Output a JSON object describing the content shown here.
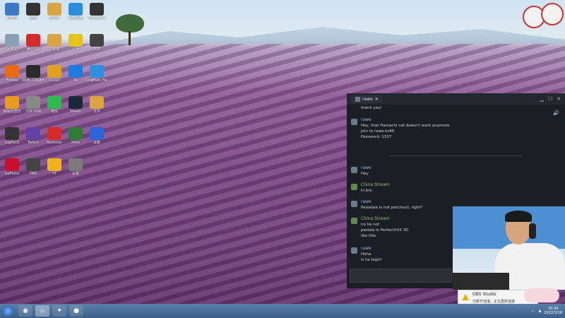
{
  "desktop": {
    "icons": [
      {
        "label": "计算机",
        "icon": "computer-icon",
        "color": "#3b78c7"
      },
      {
        "label": "游戏",
        "icon": "game-icon",
        "color": "#333333"
      },
      {
        "label": "文件夹",
        "icon": "folder-icon",
        "color": "#d9a441"
      },
      {
        "label": "百度网盘",
        "icon": "cloud-icon",
        "color": "#2b8ddb"
      },
      {
        "label": "TR6Demo",
        "icon": "demo-icon",
        "color": "#333333"
      },
      {
        "label": "回收站",
        "icon": "recycle-bin-icon",
        "color": "#8aa0b4"
      },
      {
        "label": "腾讯QQ",
        "icon": "qq-icon",
        "color": "#d62b2b"
      },
      {
        "label": "文件夹",
        "icon": "folder-icon",
        "color": "#d9a441"
      },
      {
        "label": "迅雷",
        "icon": "thunder-icon",
        "color": "#e6c21a"
      },
      {
        "label": "ZOE",
        "icon": "zoe-icon",
        "color": "#444444"
      },
      {
        "label": "Firefox",
        "icon": "firefox-icon",
        "color": "#e66b12"
      },
      {
        "label": "网易UU加速器",
        "icon": "uu-icon",
        "color": "#2a2a2a"
      },
      {
        "label": "CS:GO",
        "icon": "csgo-icon",
        "color": "#e0a21c"
      },
      {
        "label": "KK",
        "icon": "kk-icon",
        "color": "#1f7be0"
      },
      {
        "label": "LogMeIn Hamachi",
        "icon": "hamachi-icon",
        "color": "#2f8fe0"
      },
      {
        "label": "网易云音乐",
        "icon": "music-icon",
        "color": "#e89a1a"
      },
      {
        "label": "3387506",
        "icon": "file-icon",
        "color": "#888888"
      },
      {
        "label": "微信",
        "icon": "wechat-icon",
        "color": "#2dbb4f"
      },
      {
        "label": "Steam",
        "icon": "steam-icon",
        "color": "#1b2838"
      },
      {
        "label": "文件",
        "icon": "folder-icon",
        "color": "#d9a441"
      },
      {
        "label": "Logitech",
        "icon": "logitech-icon",
        "color": "#333333"
      },
      {
        "label": "Twitch",
        "icon": "twitch-icon",
        "color": "#6441a5"
      },
      {
        "label": "Rockstar",
        "icon": "rockstar-icon",
        "color": "#d62b2b"
      },
      {
        "label": "Xbox",
        "icon": "xbox-icon",
        "color": "#2e7d32"
      },
      {
        "label": "百度",
        "icon": "baidu-icon",
        "color": "#2b63d9"
      },
      {
        "label": "GeForce",
        "icon": "geforce-icon",
        "color": "#c8102e"
      },
      {
        "label": "OBS",
        "icon": "obs-icon",
        "color": "#444444"
      },
      {
        "label": "YY",
        "icon": "yy-icon",
        "color": "#f0b21a"
      },
      {
        "label": "设置",
        "icon": "settings-icon",
        "color": "#7a7a7a"
      }
    ]
  },
  "chat": {
    "tab_label": "rawe",
    "messages": [
      {
        "id": "m0",
        "name": "",
        "time": "",
        "lines": [
          "thank you!"
        ]
      },
      {
        "id": "m1",
        "name": "rawe",
        "time": "",
        "lines": [
          "Hey, that Hamachi net doesn't work anymore",
          "Join to rawe.kz46",
          "Password: 1337"
        ]
      },
      {
        "id": "m2",
        "name": "rawe",
        "time": "",
        "lines": [
          "Hey"
        ]
      },
      {
        "id": "m3",
        "name": "China Stream",
        "time": "",
        "lines": [
          "hi bro"
        ]
      },
      {
        "id": "m4",
        "name": "rawe",
        "time": "",
        "lines": [
          "Paslalala is not patchouli, right?"
        ]
      },
      {
        "id": "m5",
        "name": "China Stream",
        "time": "",
        "lines": [
          "no he not",
          "paslala is PerfectXXX 3D",
          "like this"
        ]
      },
      {
        "id": "m6",
        "name": "rawe",
        "time": "",
        "lines": [
          "Haha",
          "is he legit?"
        ]
      }
    ]
  },
  "notification": {
    "title": "OBS Studio",
    "subtitle": "已断开连接，正在重新连接"
  },
  "taskbar": {
    "clock_time": "20:34",
    "clock_date": "2022/3/18"
  },
  "colors": {
    "chat_bg": "#1b1e24",
    "steam_name": "#8fb8d9",
    "china_name": "#8fc56b"
  }
}
